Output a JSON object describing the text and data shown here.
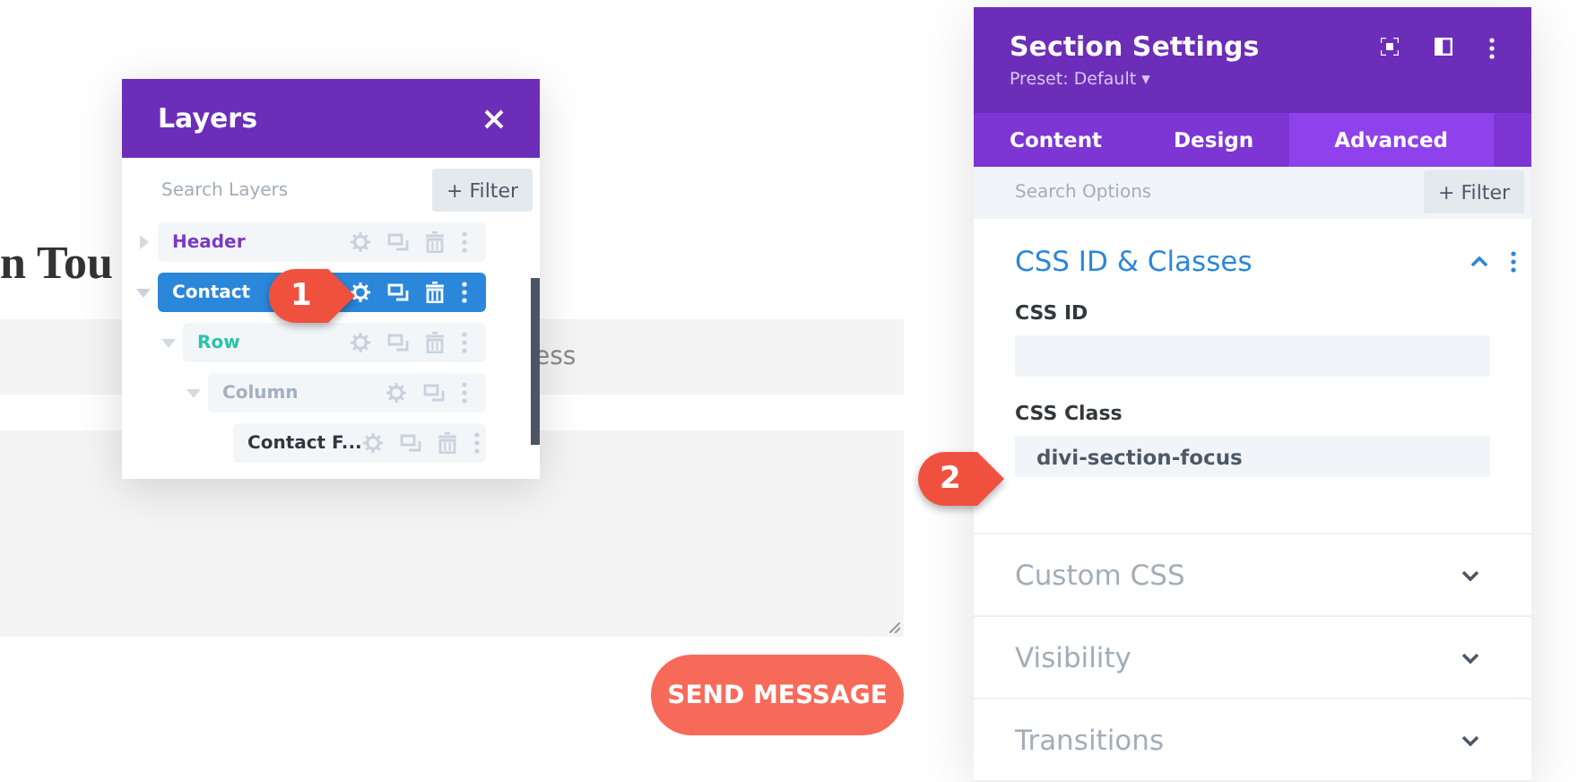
{
  "page": {
    "heading": "n Tou",
    "email_text": "ess",
    "send_button": "SEND MESSAGE"
  },
  "layers_panel": {
    "title": "Layers",
    "search": {
      "placeholder": "Search Layers"
    },
    "filter_button": "+ Filter",
    "tree": [
      {
        "label": "Header",
        "kind": "section",
        "expanded": false,
        "selected": false
      },
      {
        "label": "Contact",
        "kind": "section",
        "expanded": true,
        "selected": true,
        "children": [
          {
            "label": "Row",
            "kind": "row",
            "expanded": true,
            "selected": false,
            "children": [
              {
                "label": "Column",
                "kind": "column",
                "expanded": true,
                "selected": false,
                "children": [
                  {
                    "label": "Contact F...",
                    "kind": "module",
                    "selected": false
                  }
                ]
              }
            ]
          }
        ]
      }
    ]
  },
  "settings_panel": {
    "title": "Section Settings",
    "preset": "Preset: Default ▾",
    "tabs": [
      {
        "label": "Content",
        "selected": false
      },
      {
        "label": "Design",
        "selected": false
      },
      {
        "label": "Advanced",
        "selected": true
      }
    ],
    "search": {
      "placeholder": "Search Options"
    },
    "filter_button": "+ Filter",
    "groups": [
      {
        "title": "CSS ID & Classes",
        "expanded": true,
        "fields": [
          {
            "label": "CSS ID"
          },
          {
            "label": "CSS Class",
            "value": "divi-section-focus"
          }
        ]
      },
      {
        "title": "Custom CSS",
        "expanded": false
      },
      {
        "title": "Visibility",
        "expanded": false
      },
      {
        "title": "Transitions",
        "expanded": false
      }
    ]
  },
  "callouts": [
    {
      "number": "1"
    },
    {
      "number": "2"
    }
  ]
}
